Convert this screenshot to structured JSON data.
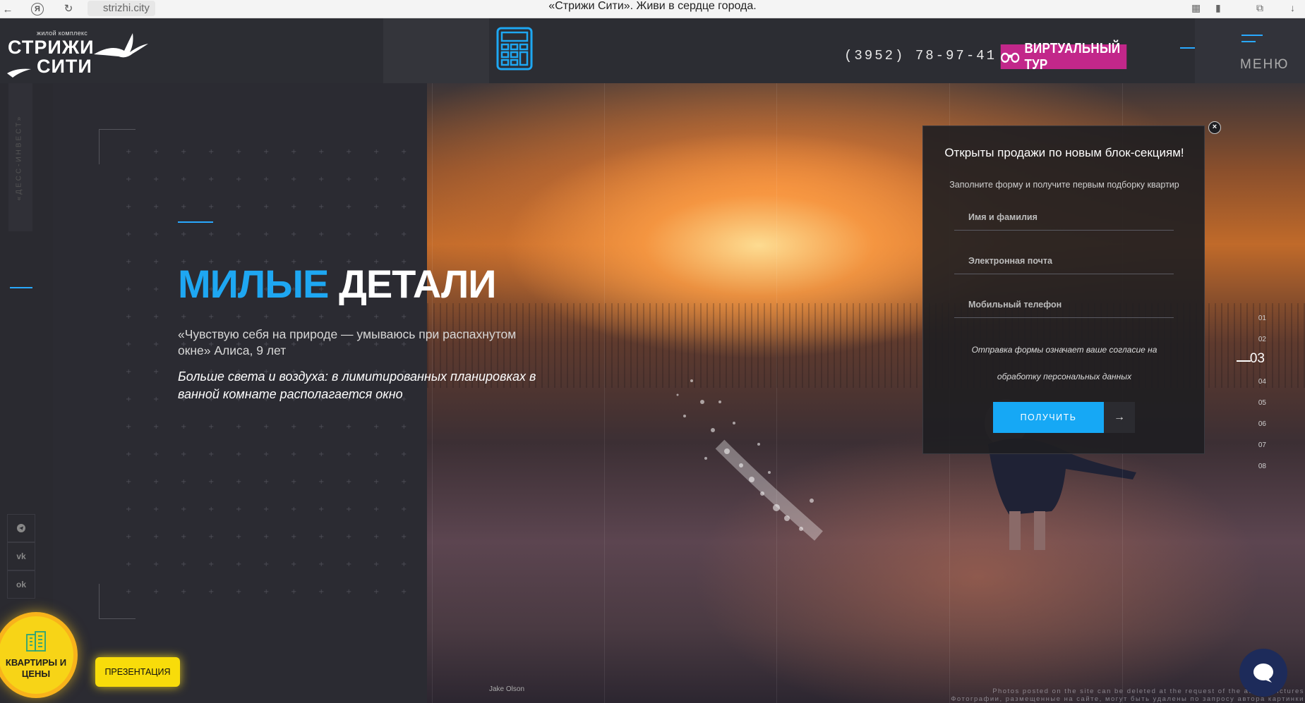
{
  "browser": {
    "url": "strizhi.city",
    "title": "«Стрижи Сити». Живи в сердце города."
  },
  "logo": {
    "small": "жилой комплекс",
    "line1": "СТРИЖИ",
    "line2": "СИТИ"
  },
  "header": {
    "phone": "(3952) 78-97-41",
    "tour_label": "ВИРТУАЛЬНЫЙ ТУР",
    "menu_label": "МЕНЮ"
  },
  "side": {
    "brand_vertical": "«ДЕСС-ИНВЕСТ»",
    "social": [
      "telegram-icon",
      "vk-icon",
      "odnoklassniki-icon"
    ]
  },
  "hero": {
    "title_highlight": "МИЛЫЕ",
    "title_rest": "ДЕТАЛИ",
    "quote": "«Чувствую себя на природе — умываюсь при распахнутом окне» Алиса, 9 лет",
    "note": "Больше света и воздуха: в лимитированных планировках в ванной комнате располагается окно",
    "photo_credit": "Jake Olson",
    "disclaimer_en": "Photos posted on the site can be deleted at the request of the author pictures",
    "disclaimer_ru": "Фотографии, размещенные на сайте, могут быть удалены по запросу автора картинки"
  },
  "slides": {
    "numbers": [
      "01",
      "02",
      "03",
      "04",
      "05",
      "06",
      "07",
      "08"
    ],
    "active": "03"
  },
  "popup": {
    "title": "Открыты продажи по новым блок-секциям!",
    "subtitle": "Заполните форму и получите первым подборку квартир",
    "name_placeholder": "Имя и фамилия",
    "email_placeholder": "Электронная почта",
    "phone_placeholder": "Мобильный телефон",
    "consent_line1": "Отправка формы означает ваше согласие на",
    "consent_line2": "обработку персональных данных",
    "submit_label": "ПОЛУЧИТЬ",
    "arrow": "→",
    "close": "×"
  },
  "bottom": {
    "apartments_label": "КВАРТИРЫ И ЦЕНЫ",
    "presentation_label": "ПРЕЗЕНТАЦИЯ"
  },
  "colors": {
    "accent_blue": "#1ea7f2",
    "tour_magenta": "#c2278a",
    "yellow": "#f7d417",
    "dark_bg": "#2b2b32"
  }
}
